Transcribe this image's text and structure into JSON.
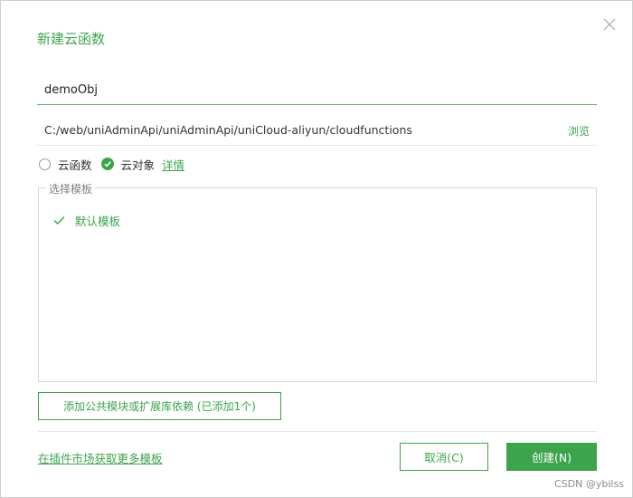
{
  "dialog": {
    "title": "新建云函数",
    "close_icon": "close-icon"
  },
  "name_input": {
    "value": "demoObj"
  },
  "path": {
    "value": "C:/web/uniAdminApi/uniAdminApi/uniCloud-aliyun/cloudfunctions",
    "browse_label": "浏览"
  },
  "type_options": [
    {
      "label": "云函数",
      "selected": false
    },
    {
      "label": "云对象",
      "selected": true
    }
  ],
  "detail_link": "详情",
  "template_section": {
    "legend": "选择模板",
    "items": [
      {
        "label": "默认模板",
        "selected": true
      }
    ]
  },
  "deps_button": "添加公共模块或扩展库依赖 (已添加1个)",
  "market_link": "在插件市场获取更多模板",
  "cancel_button": "取消(C)",
  "create_button": "创建(N)",
  "watermark": "CSDN @ybilss",
  "colors": {
    "accent": "#3ca44c",
    "border": "#d9d9d9"
  }
}
